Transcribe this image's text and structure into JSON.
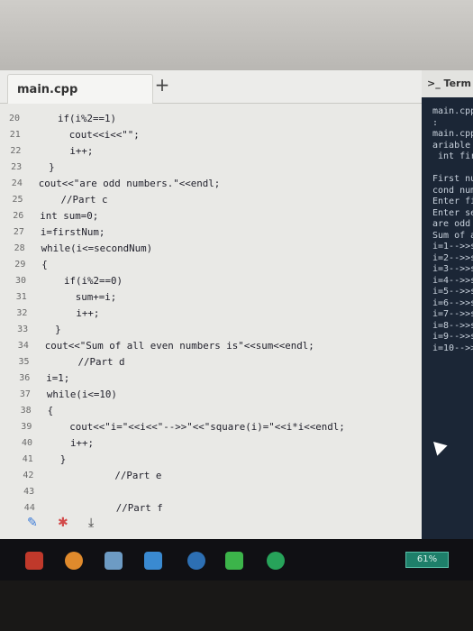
{
  "editor": {
    "tab_label": "main.cpp",
    "new_tab_symbol": "+",
    "lines": [
      {
        "n": "20",
        "t": "if(i%2==1)",
        "indent": 2
      },
      {
        "n": "21",
        "t": "cout<<i<<\"\";",
        "indent": 3
      },
      {
        "n": "22",
        "t": "i++;",
        "indent": 3
      },
      {
        "n": "23",
        "t": "}",
        "indent": 1
      },
      {
        "n": "24",
        "t": "cout<<\"are odd numbers.\"<<endl;",
        "indent": 0
      },
      {
        "n": "25",
        "t": "//Part c",
        "indent": 2
      },
      {
        "n": "26",
        "t": "int sum=0;",
        "indent": 0
      },
      {
        "n": "27",
        "t": "i=firstNum;",
        "indent": 0
      },
      {
        "n": "28",
        "t": "while(i<=secondNum)",
        "indent": 0
      },
      {
        "n": "29",
        "t": "{",
        "indent": 0
      },
      {
        "n": "30",
        "t": "if(i%2==0)",
        "indent": 2
      },
      {
        "n": "31",
        "t": "sum+=i;",
        "indent": 3
      },
      {
        "n": "32",
        "t": "i++;",
        "indent": 3
      },
      {
        "n": "33",
        "t": "}",
        "indent": 1
      },
      {
        "n": "34",
        "t": "cout<<\"Sum of all even numbers is\"<<sum<<endl;",
        "indent": 0
      },
      {
        "n": "35",
        "t": "//Part d",
        "indent": 3
      },
      {
        "n": "36",
        "t": "i=1;",
        "indent": 0
      },
      {
        "n": "37",
        "t": "while(i<=10)",
        "indent": 0
      },
      {
        "n": "38",
        "t": "{",
        "indent": 0
      },
      {
        "n": "39",
        "t": "cout<<\"i=\"<<i<<\"-->>\"<<\"square(i)=\"<<i*i<<endl;",
        "indent": 2
      },
      {
        "n": "40",
        "t": "i++;",
        "indent": 2
      },
      {
        "n": "41",
        "t": "}",
        "indent": 1
      },
      {
        "n": "42",
        "t": "//Part e",
        "indent": 6
      },
      {
        "n": "43",
        "t": "",
        "indent": 0
      },
      {
        "n": "44",
        "t": "//Part f",
        "indent": 6
      }
    ]
  },
  "terminal": {
    "tab_label": ">_ Term",
    "output": "main.cpp\n:\nmain.cpp\nariable\n int fir\n\nFirst nu\ncond num\nEnter fi\nEnter se\nare odd\nSum of a\ni=1-->>s\ni=2-->>s\ni=3-->>s\ni=4-->>s\ni=5-->>s\ni=6-->>s\ni=7-->>s\ni=8-->>s\ni=9-->>s\ni=10-->>"
  },
  "taskbar": {
    "battery_label": "61%"
  },
  "colors": {
    "terminal_bg": "#1b2636",
    "taskbar_bg": "#101014",
    "editor_bg": "#e9e9e6"
  }
}
